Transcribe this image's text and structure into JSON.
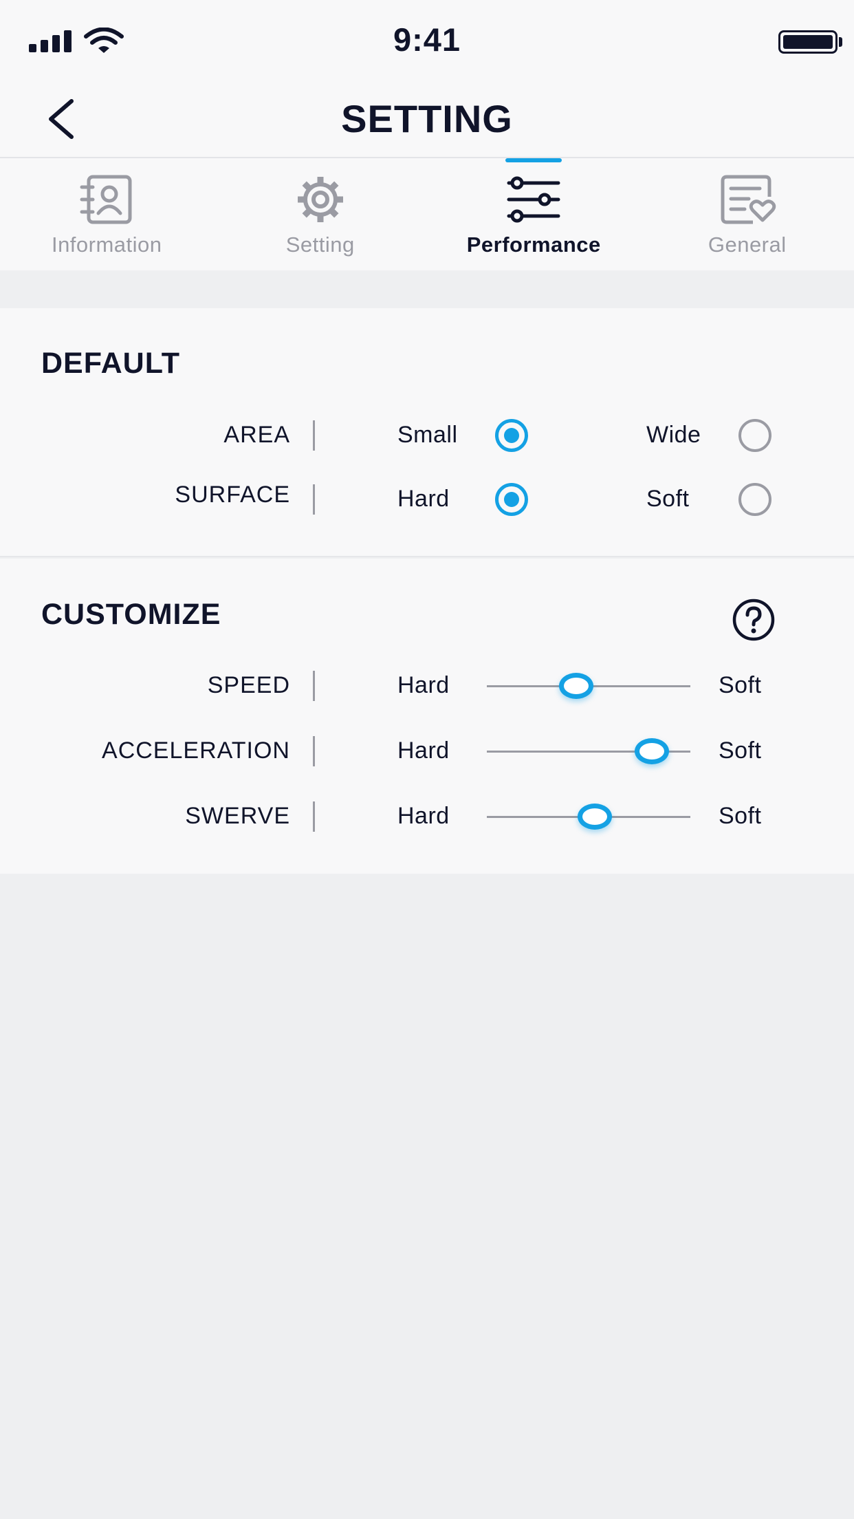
{
  "status_bar": {
    "time": "9:41"
  },
  "header": {
    "title": "SETTING"
  },
  "tabs": [
    {
      "label": "Information",
      "icon": "contact-card-icon",
      "active": false
    },
    {
      "label": "Setting",
      "icon": "gear-icon",
      "active": false
    },
    {
      "label": "Performance",
      "icon": "sliders-icon",
      "active": true
    },
    {
      "label": "General",
      "icon": "document-heart-icon",
      "active": false
    }
  ],
  "default_section": {
    "title": "DEFAULT",
    "rows": [
      {
        "label": "AREA",
        "option_a": "Small",
        "option_b": "Wide",
        "selected": "Small"
      },
      {
        "label": "SURFACE",
        "option_a": "Hard",
        "option_b": "Soft",
        "selected": "Hard"
      }
    ]
  },
  "customize_section": {
    "title": "CUSTOMIZE",
    "help_icon": "question-circle-icon",
    "sliders": [
      {
        "label": "SPEED",
        "min_label": "Hard",
        "max_label": "Soft",
        "value": 0.44
      },
      {
        "label": "ACCELERATION",
        "min_label": "Hard",
        "max_label": "Soft",
        "value": 0.81
      },
      {
        "label": "SWERVE",
        "min_label": "Hard",
        "max_label": "Soft",
        "value": 0.53
      }
    ]
  },
  "colors": {
    "accent": "#14a1e4",
    "text": "#10142a",
    "muted": "#9a9ba3",
    "background": "#eeeff1",
    "surface": "#f8f8f9"
  }
}
